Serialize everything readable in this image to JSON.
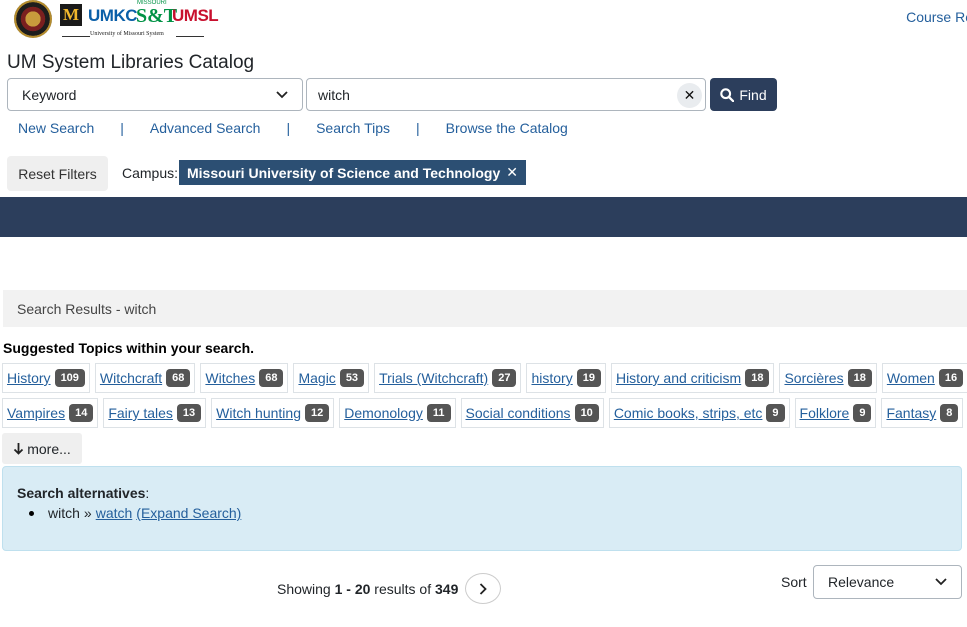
{
  "header": {
    "logos": {
      "umkc": "UMKC",
      "st_small": "MISSOURI",
      "st": "S&T",
      "umsl": "UMSL",
      "mizzou": "M",
      "ums_caption": "University of Missouri System"
    },
    "course_link": "Course Re"
  },
  "app_title": "UM System Libraries Catalog",
  "search": {
    "type_selected": "Keyword",
    "query": "witch",
    "clear_label": "✕",
    "find_label": "Find"
  },
  "nav": {
    "new_search": "New Search",
    "advanced_search": "Advanced Search",
    "search_tips": "Search Tips",
    "browse": "Browse the Catalog",
    "separator": "|"
  },
  "filters": {
    "reset_label": "Reset Filters",
    "campus_label": "Campus:",
    "campus_value": "Missouri University of Science and Technology",
    "remove_label": "✕"
  },
  "results": {
    "header": "Search Results - witch",
    "topics_heading": "Suggested Topics within your search.",
    "topics_row1": [
      {
        "label": "History",
        "count": "109"
      },
      {
        "label": "Witchcraft",
        "count": "68"
      },
      {
        "label": "Witches",
        "count": "68"
      },
      {
        "label": "Magic",
        "count": "53"
      },
      {
        "label": "Trials (Witchcraft)",
        "count": "27"
      },
      {
        "label": "history",
        "count": "19"
      },
      {
        "label": "History and criticism",
        "count": "18"
      },
      {
        "label": "Sorcières",
        "count": "18"
      },
      {
        "label": "Women",
        "count": "16"
      }
    ],
    "topics_row2": [
      {
        "label": "Vampires",
        "count": "14"
      },
      {
        "label": "Fairy tales",
        "count": "13"
      },
      {
        "label": "Witch hunting",
        "count": "12"
      },
      {
        "label": "Demonology",
        "count": "11"
      },
      {
        "label": "Social conditions",
        "count": "10"
      },
      {
        "label": "Comic books, strips, etc",
        "count": "9"
      },
      {
        "label": "Folklore",
        "count": "9"
      },
      {
        "label": "Fantasy",
        "count": "8"
      }
    ],
    "more_label": "more...",
    "alternatives": {
      "title": "Search alternatives",
      "colon": ":",
      "term": "witch",
      "arrow": "»",
      "suggestion": "watch",
      "expand": "(Expand Search)"
    },
    "showing": {
      "prefix": "Showing",
      "range": "1 - 20",
      "middle": "results of",
      "total": "349"
    },
    "sort": {
      "label": "Sort",
      "selected": "Relevance"
    }
  },
  "colors": {
    "primary": "#2c3e5c",
    "link": "#245f9c",
    "chip": "#2c4f73",
    "badge": "#555555",
    "alert_bg": "#d9ecf5"
  }
}
